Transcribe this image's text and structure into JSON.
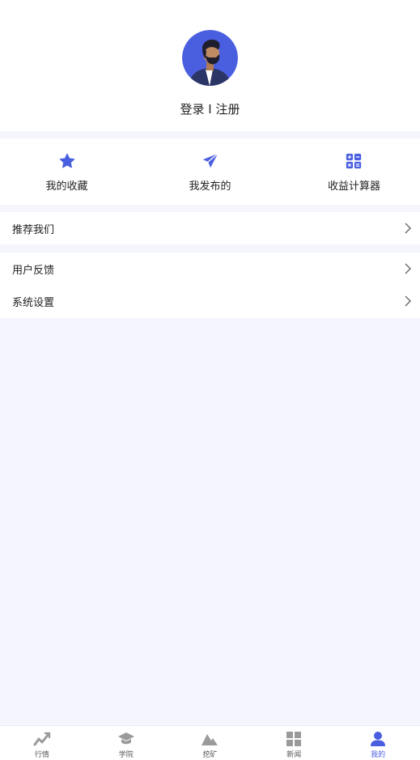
{
  "colors": {
    "accent": "#4a5ee0",
    "background": "#f4f5fd",
    "inactive_icon": "#9a9a9a"
  },
  "profile": {
    "avatar_icon": "avatar-icon",
    "login_label": "登录 I 注册"
  },
  "quick_actions": [
    {
      "label": "我的收藏",
      "icon": "star-icon"
    },
    {
      "label": "我发布的",
      "icon": "paper-plane-icon"
    },
    {
      "label": "收益计算器",
      "icon": "calculator-icon"
    }
  ],
  "menu": {
    "group1": [
      {
        "label": "推荐我们"
      }
    ],
    "group2": [
      {
        "label": "用户反馈"
      },
      {
        "label": "系统设置"
      }
    ]
  },
  "tabbar": {
    "active": "我的",
    "tabs": [
      {
        "label": "行情",
        "icon": "trend-icon"
      },
      {
        "label": "学院",
        "icon": "graduation-cap-icon"
      },
      {
        "label": "挖矿",
        "icon": "mountain-icon"
      },
      {
        "label": "新闻",
        "icon": "grid-icon"
      },
      {
        "label": "我的",
        "icon": "user-icon"
      }
    ]
  }
}
